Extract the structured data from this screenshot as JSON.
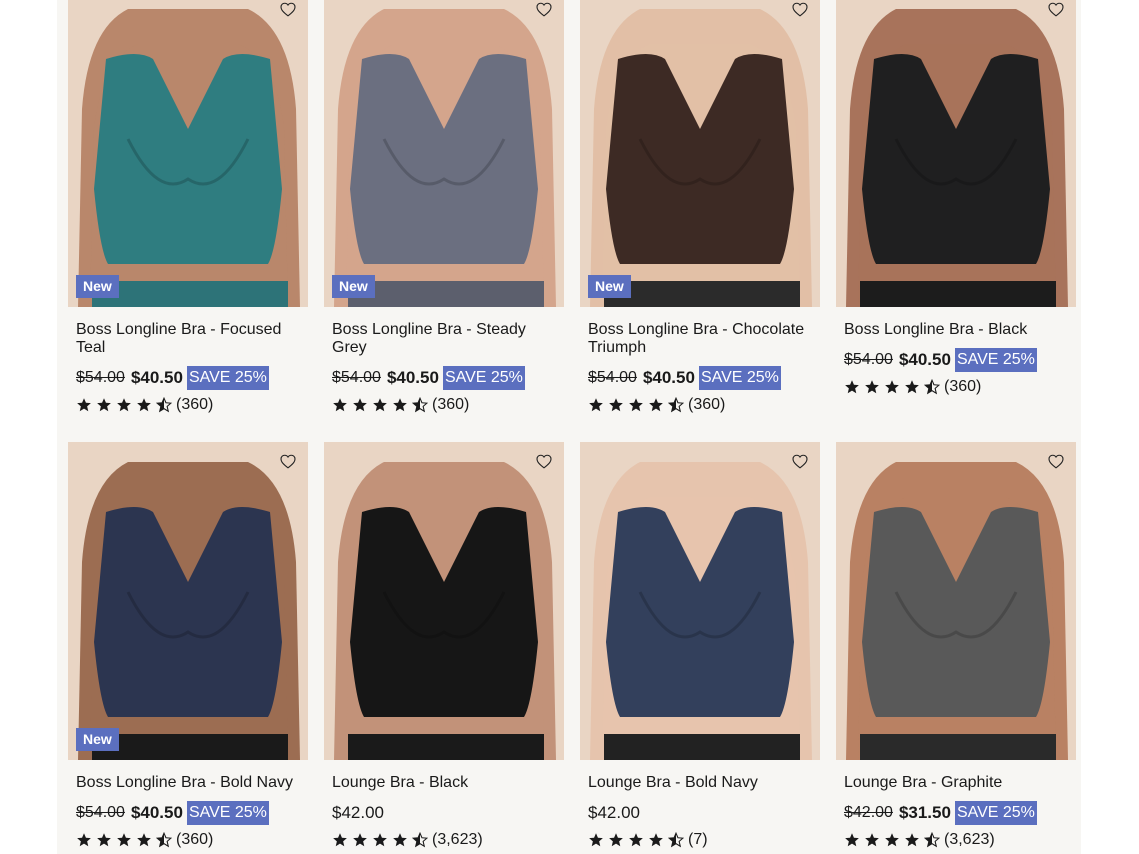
{
  "colors": {
    "accent": "#5b6fbf",
    "background": "#f7f6f3"
  },
  "products": [
    {
      "title": "Boss Longline Bra - Focused Teal",
      "badge": "New",
      "price_original": "$54.00",
      "price": "$40.50",
      "save": "SAVE 25%",
      "rating": 4.5,
      "reviews": "(360)",
      "color": "#2f7d80",
      "skin": "#b9876b",
      "bottom": "#2d7378"
    },
    {
      "title": "Boss Longline Bra - Steady Grey",
      "badge": "New",
      "price_original": "$54.00",
      "price": "$40.50",
      "save": "SAVE 25%",
      "rating": 4.5,
      "reviews": "(360)",
      "color": "#6b6f80",
      "skin": "#d4a58c",
      "bottom": "#5c5f6d"
    },
    {
      "title": "Boss Longline Bra - Chocolate Triumph",
      "badge": "New",
      "price_original": "$54.00",
      "price": "$40.50",
      "save": "SAVE 25%",
      "rating": 4.5,
      "reviews": "(360)",
      "color": "#3d2a24",
      "skin": "#e2bfa6",
      "bottom": "#2b2b2b"
    },
    {
      "title": "Boss Longline Bra - Black",
      "badge": "",
      "price_original": "$54.00",
      "price": "$40.50",
      "save": "SAVE 25%",
      "rating": 4.5,
      "reviews": "(360)",
      "color": "#1f1f20",
      "skin": "#a8735b",
      "bottom": "#1c1c1c"
    },
    {
      "title": "Boss Longline Bra - Bold Navy",
      "badge": "New",
      "price_original": "$54.00",
      "price": "$40.50",
      "save": "SAVE 25%",
      "rating": 4.5,
      "reviews": "(360)",
      "color": "#2c3550",
      "skin": "#9c6d52",
      "bottom": "#1a1a1a"
    },
    {
      "title": "Lounge Bra - Black",
      "badge": "",
      "price_original": "",
      "price": "$42.00",
      "save": "",
      "rating": 4.5,
      "reviews": "(3,623)",
      "color": "#161616",
      "skin": "#c29279",
      "bottom": "#1a1a1a"
    },
    {
      "title": "Lounge Bra - Bold Navy",
      "badge": "",
      "price_original": "",
      "price": "$42.00",
      "save": "",
      "rating": 4.5,
      "reviews": "(7)",
      "color": "#33405c",
      "skin": "#e6c4ad",
      "bottom": "#222222"
    },
    {
      "title": "Lounge Bra - Graphite",
      "badge": "",
      "price_original": "$42.00",
      "price": "$31.50",
      "save": "SAVE 25%",
      "rating": 4.5,
      "reviews": "(3,623)",
      "color": "#595959",
      "skin": "#b98163",
      "bottom": "#2a2a2a"
    }
  ]
}
